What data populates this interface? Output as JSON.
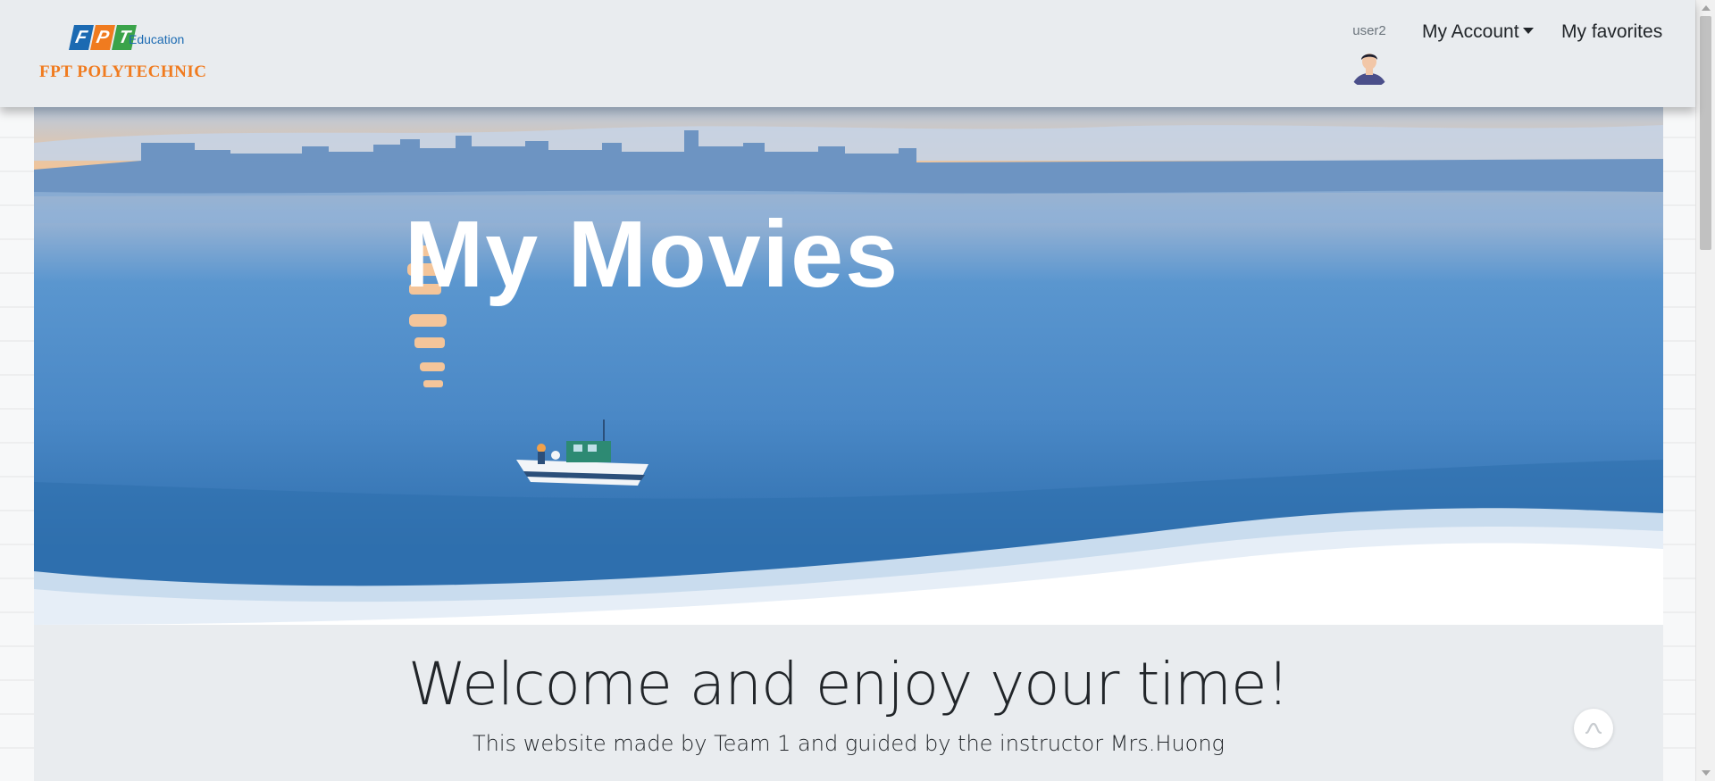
{
  "brand": {
    "logo_letters": [
      "F",
      "P",
      "T"
    ],
    "education_label": "Education",
    "name": "FPT POLYTECHNIC"
  },
  "user": {
    "name": "user2",
    "avatar_icon": "user-avatar-icon"
  },
  "nav": {
    "account_label": "My Account",
    "favorites_label": "My favorites"
  },
  "hero": {
    "title": "My Movies"
  },
  "welcome": {
    "heading": "Welcome and enjoy your time!",
    "subtext": "This website made by Team 1 and guided by the instructor Mrs.Huong"
  },
  "colors": {
    "navbar_bg": "#e9ecef",
    "brand_orange": "#f07b1f",
    "brand_blue": "#1b6ab2",
    "brand_green": "#3aa34a",
    "hero_water": "#4a88c6"
  }
}
